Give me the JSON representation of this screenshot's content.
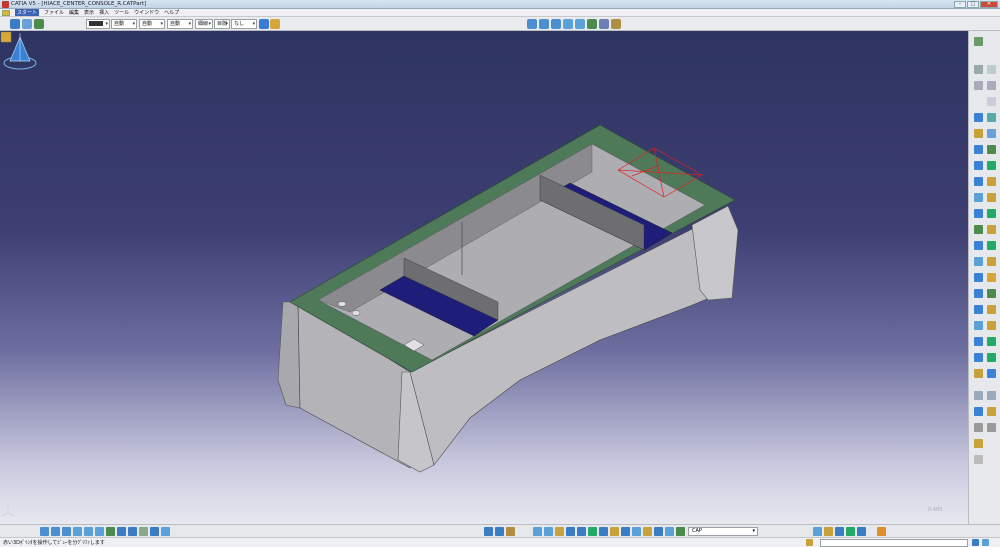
{
  "window": {
    "title": "CATIA V5 - [HIACE_CENTER_CONSOLE_R.CATPart]"
  },
  "menu": {
    "items": [
      "スタート",
      "ファイル",
      "編集",
      "表示",
      "挿入",
      "ツール",
      "ウインドウ",
      "ヘルプ"
    ],
    "active_index": 0
  },
  "toolbar": {
    "color_select": "",
    "transparency_select": "自動",
    "line_type_select": "自動",
    "line_weight_select": "自動",
    "point_select": "細線",
    "layer_label": "目隠",
    "layer_select": "なし"
  },
  "bottom": {
    "cap_value": "CAP"
  },
  "status": {
    "message": "赤い3Dﾎﾟｲﾝﾀを操作してﾋﾞｭｰを分ｸﾞﾘﾌｧします"
  },
  "viewport": {
    "scale_label": "0.483"
  },
  "colors": {
    "bg_top": "#2e3461",
    "bg_bottom": "#e8e8f0",
    "part_top": "#4f7a5a",
    "part_wall": "#b8b8bc",
    "part_inner": "#1e1e7a",
    "red_manip": "#e02020"
  }
}
